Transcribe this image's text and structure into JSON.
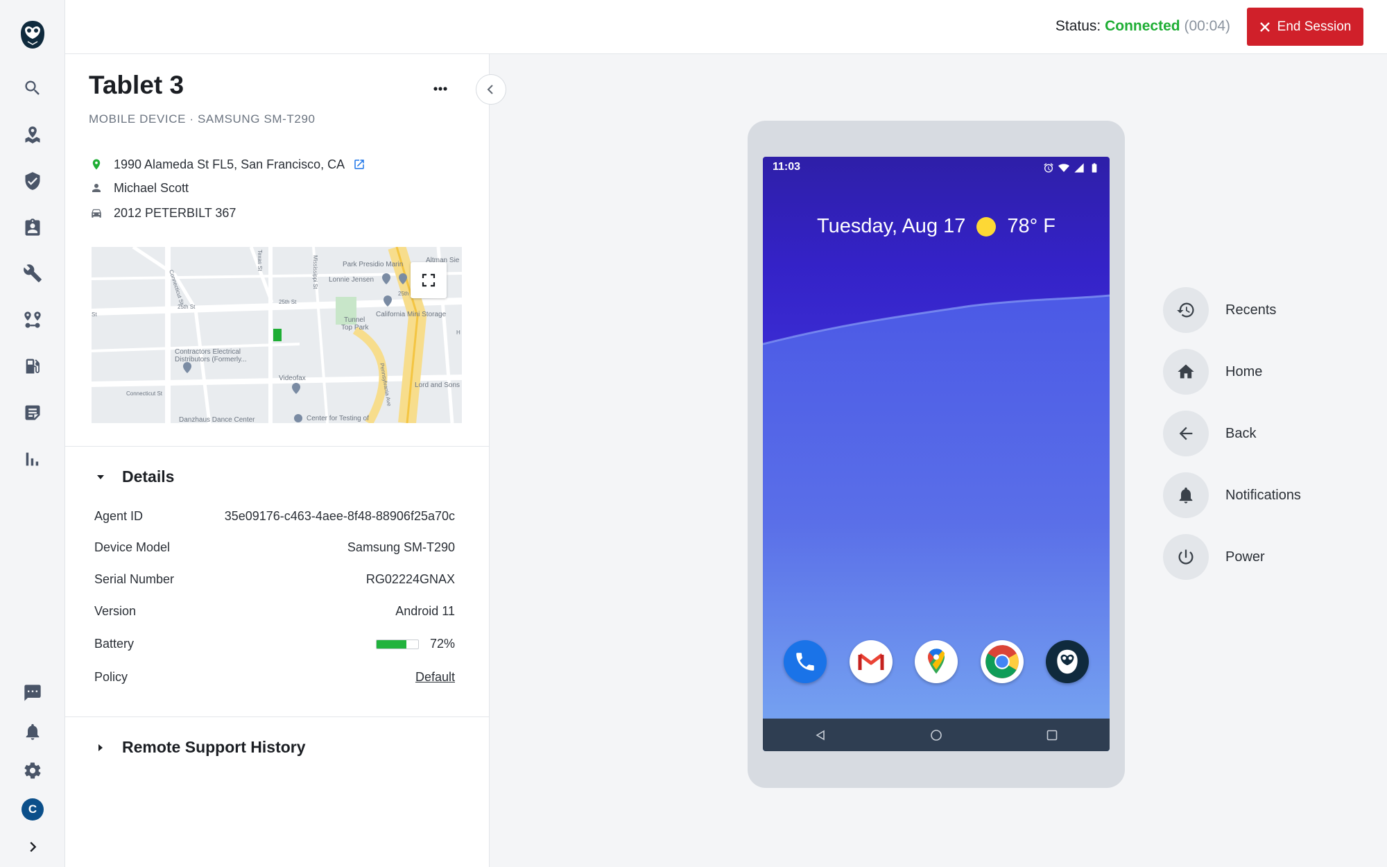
{
  "nav": {
    "items": [
      {
        "icon": "search-icon"
      },
      {
        "icon": "map-pin-icon"
      },
      {
        "icon": "shield-check-icon"
      },
      {
        "icon": "clipboard-user-icon"
      },
      {
        "icon": "wrench-icon"
      },
      {
        "icon": "route-icon"
      },
      {
        "icon": "fuel-icon"
      },
      {
        "icon": "document-icon"
      },
      {
        "icon": "bar-chart-icon"
      }
    ],
    "bottom_items": [
      {
        "icon": "chat-icon"
      },
      {
        "icon": "bell-icon"
      },
      {
        "icon": "gear-icon"
      }
    ],
    "avatar_initial": "C"
  },
  "topbar": {
    "status_label": "Status:",
    "status_value": "Connected",
    "status_timer": "(00:04)",
    "end_session_label": "End Session",
    "end_session_color": "#d0202a",
    "connected_color": "#1fae35"
  },
  "device": {
    "title": "Tablet 3",
    "subtitle": "MOBILE DEVICE · SAMSUNG SM-T290",
    "address": "1990 Alameda St FL5, San Francisco, CA",
    "driver": "Michael Scott",
    "vehicle": "2012 PETERBILT 367"
  },
  "map": {
    "labels": {
      "park_presidio": "Park Presidio Marin",
      "altman": "Altman Sie",
      "lonnie": "Lonnie Jensen",
      "california_storage": "California Mini Storage",
      "tunnel_top": "Tunnel\nTop Park",
      "contractors": "Contractors Electrical\nDistributors (Formerly...",
      "videofax": "Videofax",
      "lord_sons": "Lord and Sons",
      "danzhaus": "Danzhaus Dance Center",
      "center_testing": "Center for Testing of",
      "st_25th_a": "25th St",
      "st_25th_b": "25th St",
      "st_25th_c": "25th",
      "connecticut": "Connecticut St",
      "connecticut2": "Connecticut St",
      "texas": "Texas St",
      "mississippi": "Mississippi St",
      "pennsylvania": "Pennsylvania Ave",
      "st": "St",
      "h": "H"
    }
  },
  "details": {
    "heading": "Details",
    "rows": [
      {
        "key": "Agent ID",
        "value": "35e09176-c463-4aee-8f48-88906f25a70c"
      },
      {
        "key": "Device Model",
        "value": "Samsung SM-T290"
      },
      {
        "key": "Serial Number",
        "value": "RG02224GNAX"
      },
      {
        "key": "Version",
        "value": "Android 11"
      }
    ],
    "battery_label": "Battery",
    "battery_text": "72%",
    "battery_level": 0.72,
    "policy_label": "Policy",
    "policy_value": "Default"
  },
  "history": {
    "heading": "Remote Support History"
  },
  "tablet": {
    "time": "11:03",
    "date": "Tuesday, Aug 17",
    "temp": "78° F",
    "apps": [
      "phone-app-icon",
      "gmail-app-icon",
      "maps-app-icon",
      "chrome-app-icon",
      "owl-app-icon"
    ]
  },
  "controls": [
    {
      "label": "Recents",
      "icon": "history-icon"
    },
    {
      "label": "Home",
      "icon": "home-icon"
    },
    {
      "label": "Back",
      "icon": "arrow-left-icon"
    },
    {
      "label": "Notifications",
      "icon": "bell-icon"
    },
    {
      "label": "Power",
      "icon": "power-icon"
    }
  ]
}
